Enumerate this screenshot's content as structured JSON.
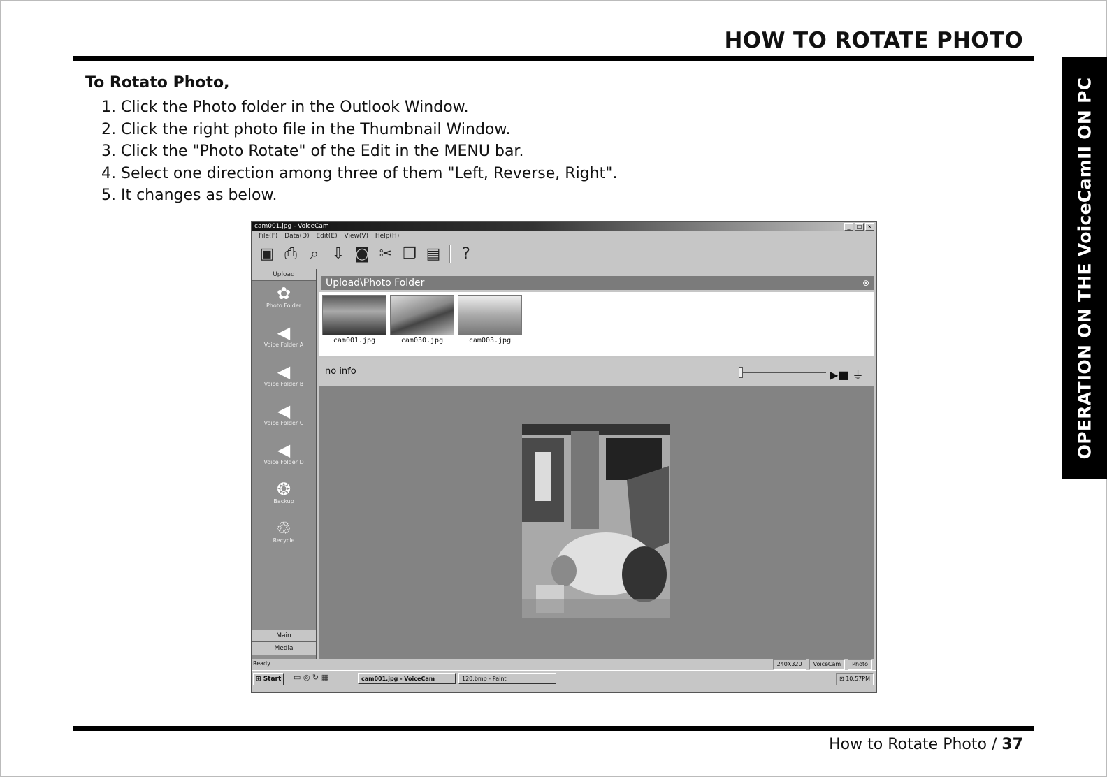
{
  "header": {
    "title": "HOW TO ROTATE PHOTO",
    "side_tab": "OPERATION ON THE VoiceCamII ON PC"
  },
  "intro": "To Rotato Photo,",
  "steps": [
    "1. Click the Photo folder in the Outlook Window.",
    "2. Click the right photo file in the Thumbnail Window.",
    "3. Click the \"Photo Rotate\" of the Edit in the MENU bar.",
    "4. Select one direction among three of them \"Left, Reverse, Right\".",
    "5. It changes as below."
  ],
  "app": {
    "title": "cam001.jpg - VoiceCam",
    "menu": [
      "File(F)",
      "Data(D)",
      "Edit(E)",
      "View(V)",
      "Help(H)"
    ],
    "toolbar_icons": [
      "save-icon",
      "print-icon",
      "preview-icon",
      "camera-download-icon",
      "camera-icon",
      "cut-icon",
      "copy-icon",
      "paste-icon",
      "help-icon"
    ],
    "outlook": {
      "header": "Upload",
      "items": [
        {
          "label": "Photo Folder",
          "icon": "palette-icon"
        },
        {
          "label": "Voice Folder A",
          "icon": "speaker-icon"
        },
        {
          "label": "Voice Folder B",
          "icon": "speaker-icon"
        },
        {
          "label": "Voice Folder C",
          "icon": "speaker-icon"
        },
        {
          "label": "Voice Folder D",
          "icon": "speaker-icon"
        },
        {
          "label": "Backup",
          "icon": "backup-icon"
        },
        {
          "label": "Recycle",
          "icon": "recycle-bin-icon"
        }
      ],
      "main": "Main",
      "media": "Media"
    },
    "folder_title": "Upload\\Photo Folder",
    "thumbnails": [
      "cam001.jpg",
      "cam030.jpg",
      "cam003.jpg"
    ],
    "info": "no info",
    "status": {
      "ready": "Ready",
      "cells": [
        "240X320",
        "VoiceCam",
        "Photo"
      ]
    },
    "taskbar": {
      "start": "Start",
      "tasks": [
        "cam001.jpg - VoiceCam",
        "120.bmp - Paint"
      ],
      "clock": "10:57PM"
    }
  },
  "footer": {
    "text": "How to Rotate Photo / ",
    "page": "37"
  }
}
